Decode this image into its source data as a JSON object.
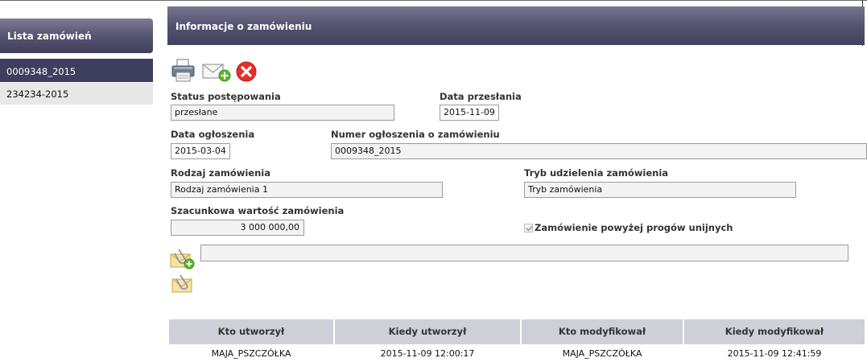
{
  "sidebar": {
    "title": "Lista zamówień",
    "items": [
      {
        "label": "0009348_2015",
        "active": true
      },
      {
        "label": "234234-2015",
        "active": false
      }
    ]
  },
  "header": {
    "title": "Informacje o zamówieniu"
  },
  "toolbar": {
    "icons": [
      "printer-icon",
      "mail-add-icon",
      "delete-icon"
    ]
  },
  "form": {
    "status": {
      "label": "Status postępowania",
      "value": "przesłane"
    },
    "sent_date": {
      "label": "Data przesłania",
      "value": "2015-11-09"
    },
    "announce_date": {
      "label": "Data ogłoszenia",
      "value": "2015-03-04"
    },
    "announce_number": {
      "label": "Numer ogłoszenia o zamówieniu",
      "value": "0009348_2015"
    },
    "order_type": {
      "label": "Rodzaj zamówienia",
      "value": "Rodzaj zamówienia 1"
    },
    "award_mode": {
      "label": "Tryb udzielenia zamówienia",
      "value": "Tryb zamówienia"
    },
    "estimated_value": {
      "label": "Szacunkowa wartość zamówienia",
      "value": "3 000 000,00"
    },
    "eu_threshold": {
      "label": "Zamówienie powyżej progów unijnych",
      "checked": true
    },
    "attachment_value": ""
  },
  "colors": {
    "sidebar_active": "#3e3e5e",
    "header_bar": "#535370",
    "table_header": "#cfcfd9",
    "delete_red": "#e0312d",
    "mail_green": "#5cb531"
  },
  "audit_table": {
    "columns": [
      "Kto utworzył",
      "Kiedy utworzył",
      "Kto modyfikował",
      "Kiedy modyfikował"
    ],
    "rows": [
      [
        "MAJA_PSZCZÓŁKA",
        "2015-11-09 12:00:17",
        "MAJA_PSZCZÓŁKA",
        "2015-11-09 12:41:59"
      ]
    ]
  }
}
